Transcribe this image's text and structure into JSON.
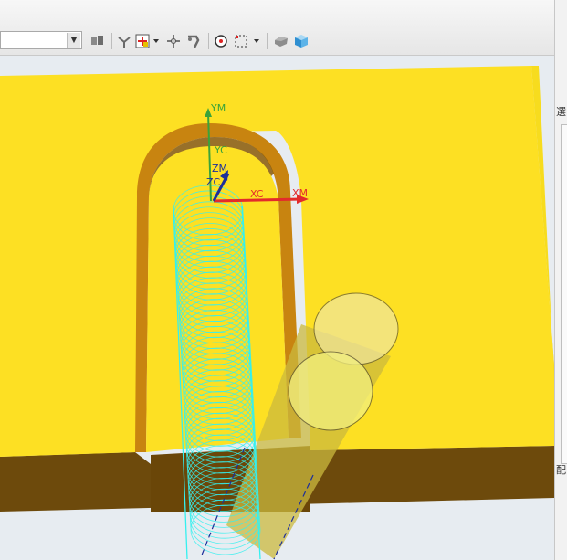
{
  "toolbar": {
    "combo_value": "",
    "buttons": [
      {
        "name": "snap-settings-icon"
      },
      {
        "name": "point-filter-icon"
      },
      {
        "name": "select-point-icon"
      },
      {
        "name": "dropdown-arrow-icon"
      },
      {
        "name": "move-handle-icon"
      },
      {
        "name": "rotate-handle-icon"
      },
      {
        "name": "circle-snap-icon"
      },
      {
        "name": "box-select-icon"
      },
      {
        "name": "shaded-view-icon"
      },
      {
        "name": "shaded-cube-icon"
      }
    ]
  },
  "right_panel": {
    "tab_1": "選",
    "tab_2": "配"
  },
  "viewport": {
    "axes": {
      "ym": "YM",
      "yc": "YC",
      "zm": "ZM",
      "zc": "ZC",
      "xc": "XC",
      "xm": "XM"
    },
    "colors": {
      "part_face": "#fde023",
      "part_side": "#6d4a0c",
      "slot_wall": "#c88410",
      "helix": "#35f0ef",
      "tool": "#cbb93e",
      "axis_x": "#e32b2b",
      "axis_y": "#3aa33a",
      "axis_z": "#1d2f9a"
    }
  }
}
